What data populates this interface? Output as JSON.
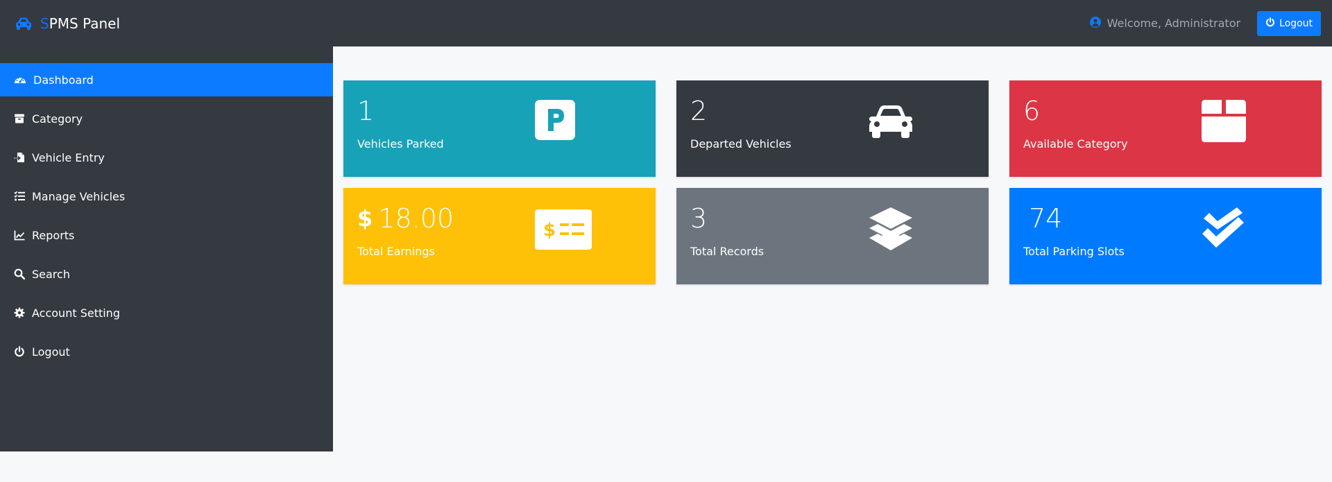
{
  "header": {
    "brand_first": "S",
    "brand_rest": "PMS Panel",
    "welcome_text": "Welcome, Administrator",
    "logout_label": "Logout"
  },
  "sidebar": {
    "items": [
      {
        "label": "Dashboard",
        "icon": "dashboard-icon",
        "active": true
      },
      {
        "label": "Category",
        "icon": "box-icon"
      },
      {
        "label": "Vehicle Entry",
        "icon": "file-import-icon"
      },
      {
        "label": "Manage Vehicles",
        "icon": "tasks-icon"
      },
      {
        "label": "Reports",
        "icon": "chart-line-icon"
      },
      {
        "label": "Search",
        "icon": "search-icon"
      },
      {
        "label": "Account Setting",
        "icon": "gear-icon"
      },
      {
        "label": "Logout",
        "icon": "power-icon"
      }
    ]
  },
  "cards": [
    {
      "value": "1",
      "label": "Vehicles Parked",
      "icon": "parking-icon",
      "color": "#17a2b8"
    },
    {
      "value": "2",
      "label": "Departed Vehicles",
      "icon": "car-icon",
      "color": "#343a40"
    },
    {
      "value": "6",
      "label": "Available Category",
      "icon": "box-icon",
      "color": "#dc3545"
    },
    {
      "value": "18.00",
      "prefix": "$",
      "label": "Total Earnings",
      "icon": "money-check-icon",
      "color": "#ffc107"
    },
    {
      "value": "3",
      "label": "Total Records",
      "icon": "layers-icon",
      "color": "#6c757d"
    },
    {
      "value": "74",
      "label": "Total Parking Slots",
      "icon": "double-check-icon",
      "color": "#007bff"
    }
  ],
  "colors": {
    "navbar": "#343a40",
    "accent": "#0d7bff",
    "page_bg": "#f7f8fa"
  }
}
